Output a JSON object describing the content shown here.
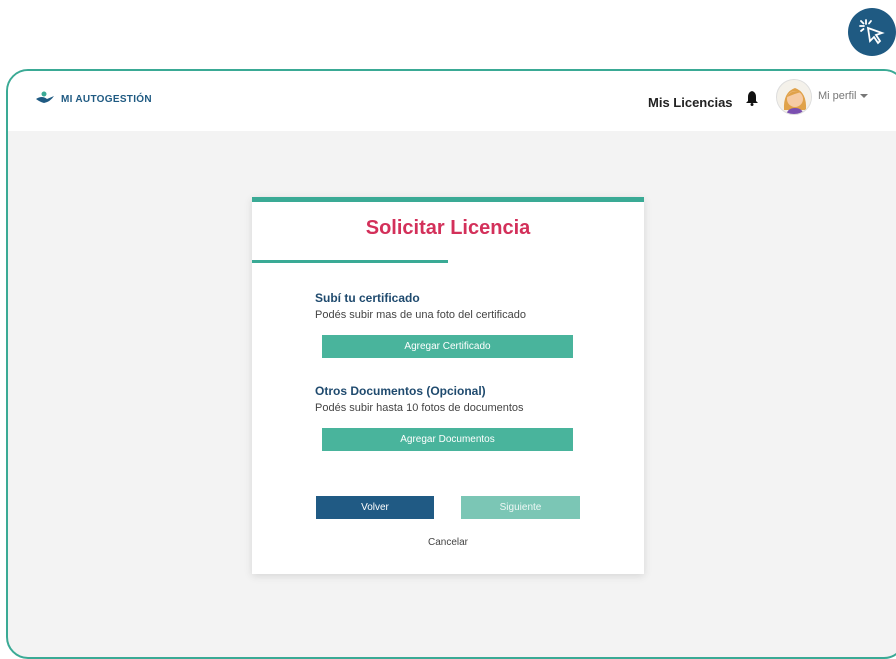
{
  "app": {
    "brand": "MI AUTOGESTIÓN"
  },
  "header": {
    "nav_link": "Mis Licencias",
    "profile_label": "Mi perfil"
  },
  "card": {
    "title": "Solicitar Licencia",
    "certificate": {
      "title": "Subí tu certificado",
      "subtitle": "Podés subir mas de una foto del certificado",
      "button": "Agregar Certificado"
    },
    "documents": {
      "title": "Otros Documentos (Opcional)",
      "subtitle": "Podés subir hasta 10 fotos de documentos",
      "button": "Agregar Documentos"
    },
    "back_button": "Volver",
    "next_button": "Siguiente",
    "cancel_link": "Cancelar"
  },
  "colors": {
    "brand_blue": "#1f5a82",
    "accent_green": "#49b49c",
    "title_pink": "#d3305a"
  },
  "icons": [
    "click-cursor-icon",
    "logo-mark-icon",
    "bell-icon",
    "avatar"
  ]
}
